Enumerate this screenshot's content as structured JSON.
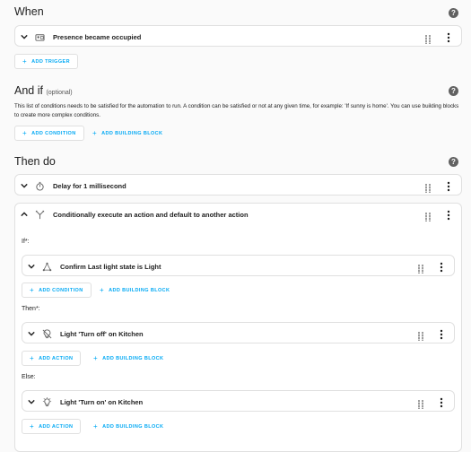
{
  "trigger_section": {
    "title": "When",
    "trigger": {
      "label": "Presence became occupied"
    },
    "add_trigger": "ADD TRIGGER"
  },
  "condition_section": {
    "title": "And if",
    "optional": "(optional)",
    "description": "This list of conditions needs to be satisfied for the automation to run. A condition can be satisfied or not at any given time, for example: 'If sunny is home'. You can use building blocks to create more complex conditions.",
    "add_condition": "ADD CONDITION",
    "add_building_block": "ADD BUILDING BLOCK"
  },
  "action_section": {
    "title": "Then do",
    "delay": {
      "label": "Delay for 1 millisecond"
    },
    "choose": {
      "label": "Conditionally execute an action and default to another action",
      "if_label": "If*:",
      "if_item": "Confirm Last light state is Light",
      "then_label": "Then*:",
      "then_item": "Light 'Turn off' on Kitchen",
      "else_label": "Else:",
      "else_item": "Light 'Turn on' on Kitchen",
      "add_condition": "ADD CONDITION",
      "add_action": "ADD ACTION",
      "add_building_block": "ADD BUILDING BLOCK"
    }
  },
  "colors": {
    "accent": "#03a9f4",
    "background": "#fafafa",
    "card": "#ffffff"
  }
}
